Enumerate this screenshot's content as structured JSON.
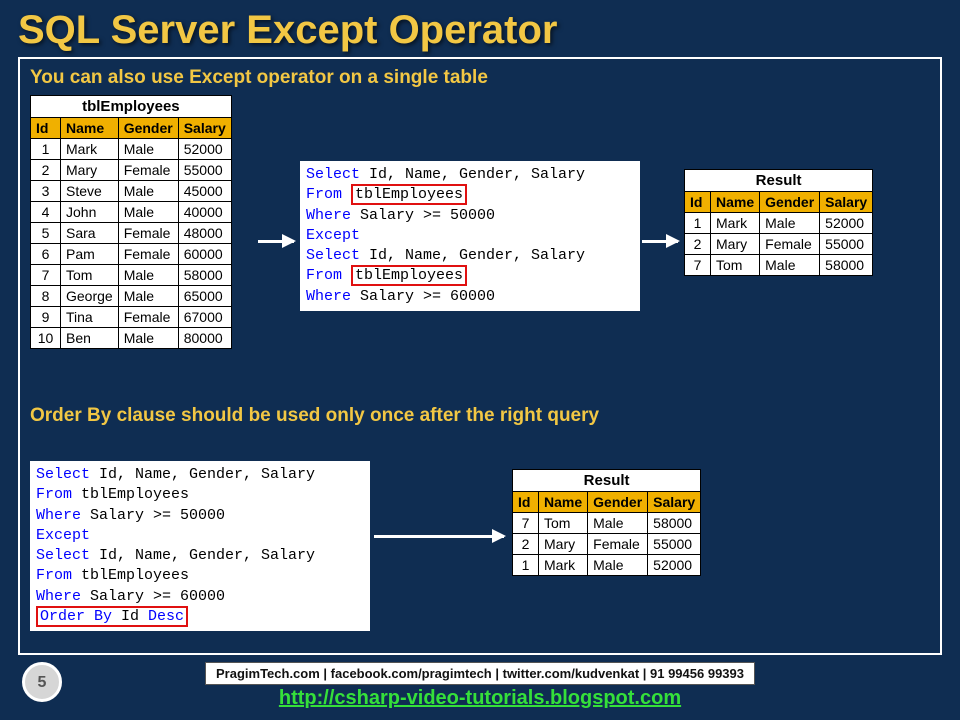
{
  "title": "SQL Server Except Operator",
  "subtitle1": "You can also use Except operator on a single table",
  "subtitle2": "Order By clause should be used only once after the right query",
  "employees": {
    "caption": "tblEmployees",
    "headers": {
      "id": "Id",
      "name": "Name",
      "gender": "Gender",
      "salary": "Salary"
    },
    "rows": [
      {
        "id": "1",
        "name": "Mark",
        "gender": "Male",
        "salary": "52000"
      },
      {
        "id": "2",
        "name": "Mary",
        "gender": "Female",
        "salary": "55000"
      },
      {
        "id": "3",
        "name": "Steve",
        "gender": "Male",
        "salary": "45000"
      },
      {
        "id": "4",
        "name": "John",
        "gender": "Male",
        "salary": "40000"
      },
      {
        "id": "5",
        "name": "Sara",
        "gender": "Female",
        "salary": "48000"
      },
      {
        "id": "6",
        "name": "Pam",
        "gender": "Female",
        "salary": "60000"
      },
      {
        "id": "7",
        "name": "Tom",
        "gender": "Male",
        "salary": "58000"
      },
      {
        "id": "8",
        "name": "George",
        "gender": "Male",
        "salary": "65000"
      },
      {
        "id": "9",
        "name": "Tina",
        "gender": "Female",
        "salary": "67000"
      },
      {
        "id": "10",
        "name": "Ben",
        "gender": "Male",
        "salary": "80000"
      }
    ]
  },
  "code1": {
    "l1a": "Select",
    "l1b": " Id, Name, Gender, Salary",
    "l2a": "From ",
    "l2b": "tblEmployees",
    "l3a": "Where",
    "l3b": " Salary >= 50000",
    "l4": "Except",
    "l5a": "Select",
    "l5b": " Id, Name, Gender, Salary",
    "l6a": "From ",
    "l6b": "tblEmployees",
    "l7a": "Where",
    "l7b": " Salary >= 60000"
  },
  "code2": {
    "l1a": "Select",
    "l1b": " Id, Name, Gender, Salary",
    "l2a": "From",
    "l2b": " tblEmployees",
    "l3a": "Where",
    "l3b": " Salary >= 50000",
    "l4": "Except",
    "l5a": "Select",
    "l5b": " Id, Name, Gender, Salary",
    "l6a": "From",
    "l6b": " tblEmployees",
    "l7a": "Where",
    "l7b": " Salary >= 60000",
    "l8a": "Order By",
    "l8b": " Id ",
    "l8c": "Desc"
  },
  "result1": {
    "caption": "Result",
    "headers": {
      "id": "Id",
      "name": "Name",
      "gender": "Gender",
      "salary": "Salary"
    },
    "rows": [
      {
        "id": "1",
        "name": "Mark",
        "gender": "Male",
        "salary": "52000"
      },
      {
        "id": "2",
        "name": "Mary",
        "gender": "Female",
        "salary": "55000"
      },
      {
        "id": "7",
        "name": "Tom",
        "gender": "Male",
        "salary": "58000"
      }
    ]
  },
  "result2": {
    "caption": "Result",
    "headers": {
      "id": "Id",
      "name": "Name",
      "gender": "Gender",
      "salary": "Salary"
    },
    "rows": [
      {
        "id": "7",
        "name": "Tom",
        "gender": "Male",
        "salary": "58000"
      },
      {
        "id": "2",
        "name": "Mary",
        "gender": "Female",
        "salary": "55000"
      },
      {
        "id": "1",
        "name": "Mark",
        "gender": "Male",
        "salary": "52000"
      }
    ]
  },
  "footer": {
    "strip": "PragimTech.com | facebook.com/pragimtech | twitter.com/kudvenkat | 91 99456 99393",
    "link": "http://csharp-video-tutorials.blogspot.com"
  },
  "page": "5"
}
